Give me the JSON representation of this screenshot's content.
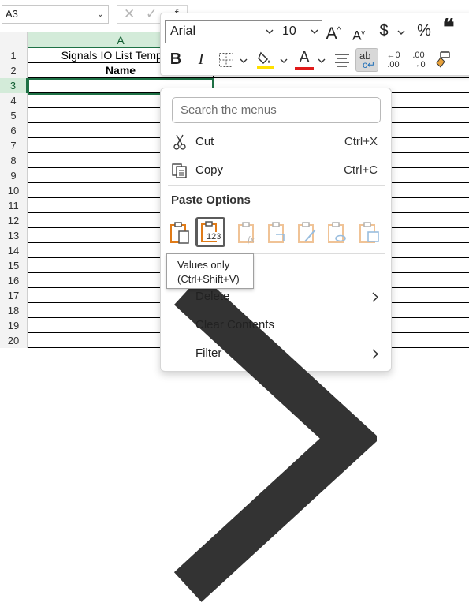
{
  "name_box": {
    "value": "A3"
  },
  "grid": {
    "column_a_label": "A",
    "rows": [
      "1",
      "2",
      "3",
      "4",
      "5",
      "6",
      "7",
      "8",
      "9",
      "10",
      "11",
      "12",
      "13",
      "14",
      "15",
      "16",
      "17",
      "18",
      "19",
      "20"
    ],
    "selected_row": "3",
    "cells": {
      "a1": "Signals IO List Template",
      "a2": "Name"
    }
  },
  "mini_toolbar": {
    "font_name": "Arial",
    "font_size": "10",
    "increase_font_glyph": "A",
    "decrease_font_glyph": "A",
    "currency_glyph": "$",
    "percent_glyph": "%",
    "bold_glyph": "B",
    "italic_glyph": "I",
    "font_color_glyph": "A",
    "wrap_text_glyph": "ab",
    "increase_decimal_glyph": "←0 .00",
    "decrease_decimal_glyph": ".00 →0",
    "fill_color": "#ffe000",
    "font_color": "#e01a1a"
  },
  "context_menu": {
    "search_placeholder": "Search the menus",
    "cut": {
      "label": "Cut",
      "shortcut": "Ctrl+X"
    },
    "copy": {
      "label": "Copy",
      "shortcut": "Ctrl+C"
    },
    "paste_options_header": "Paste Options",
    "paste_values_glyph": "123",
    "delete": {
      "label": "Delete"
    },
    "clear_contents": {
      "label": "Clear Contents"
    },
    "filter": {
      "label": "Filter"
    }
  },
  "tooltip": {
    "line1": "Values only",
    "line2": "(Ctrl+Shift+V)"
  },
  "colors": {
    "accent": "#1e7145",
    "column_header_selected": "#d3ebd9",
    "paste_icon_orange": "#e07b18"
  }
}
